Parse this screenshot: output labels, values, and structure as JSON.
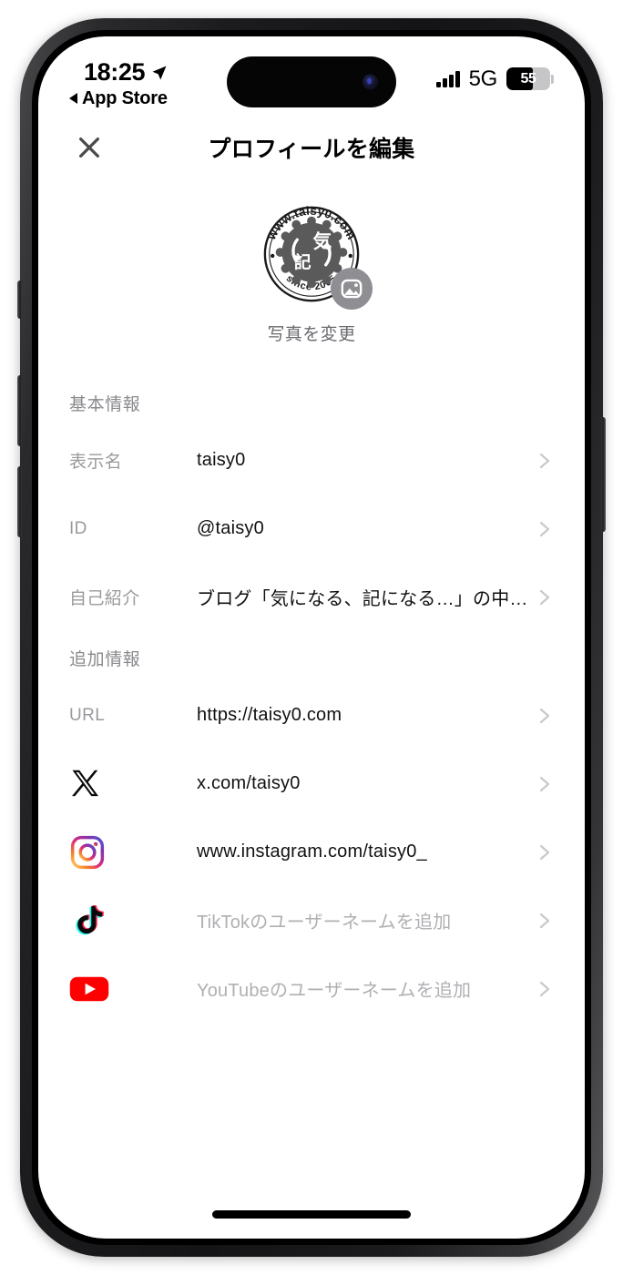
{
  "status_bar": {
    "time": "18:25",
    "location_icon": "location-arrow-icon",
    "back_app_label": "App Store",
    "back_icon": "back-triangle-icon",
    "signal_icon": "signal-bars-icon",
    "network": "5G",
    "battery_percent": "55",
    "battery_fill_ratio": 0.6
  },
  "nav": {
    "close_icon": "close-x-icon",
    "title": "プロフィールを編集"
  },
  "avatar": {
    "alt": "taisy0-logo-avatar",
    "ring_top_text": "www.taisy0.com",
    "ring_bottom_text": "since 2005",
    "inner_char_1": "気",
    "inner_char_2": "記",
    "badge_icon": "photo-camera-icon",
    "change_photo_label": "写真を変更"
  },
  "sections": [
    {
      "heading": "基本情報",
      "rows": [
        {
          "label": "表示名",
          "value": "taisy0",
          "is_placeholder": false,
          "icon": null,
          "chevron": "chevron-right-icon"
        },
        {
          "label": "ID",
          "value": "@taisy0",
          "is_placeholder": false,
          "icon": null,
          "chevron": "chevron-right-icon"
        },
        {
          "label": "自己紹介",
          "value": "ブログ「気になる、記になる…」の中の人",
          "is_placeholder": false,
          "icon": null,
          "chevron": "chevron-right-icon"
        }
      ]
    },
    {
      "heading": "追加情報",
      "rows": [
        {
          "label": "URL",
          "value": "https://taisy0.com",
          "is_placeholder": false,
          "icon": null,
          "chevron": "chevron-right-icon"
        },
        {
          "label": null,
          "value": "x.com/taisy0",
          "is_placeholder": false,
          "icon": "x-logo-icon",
          "chevron": "chevron-right-icon"
        },
        {
          "label": null,
          "value": "www.instagram.com/taisy0_",
          "is_placeholder": false,
          "icon": "instagram-logo-icon",
          "chevron": "chevron-right-icon"
        },
        {
          "label": null,
          "value": "TikTokのユーザーネームを追加",
          "is_placeholder": true,
          "icon": "tiktok-logo-icon",
          "chevron": "chevron-right-icon"
        },
        {
          "label": null,
          "value": "YouTubeのユーザーネームを追加",
          "is_placeholder": true,
          "icon": "youtube-logo-icon",
          "chevron": "chevron-right-icon"
        }
      ]
    }
  ],
  "home_indicator": "home-indicator-bar",
  "colors": {
    "background": "#ffffff",
    "primary_text": "#111111",
    "secondary_text": "#9a9a9e",
    "placeholder_text": "#b0b0b4",
    "chevron": "#c9c9cd",
    "youtube_red": "#ff0000",
    "badge_gray": "#8e8e93"
  }
}
